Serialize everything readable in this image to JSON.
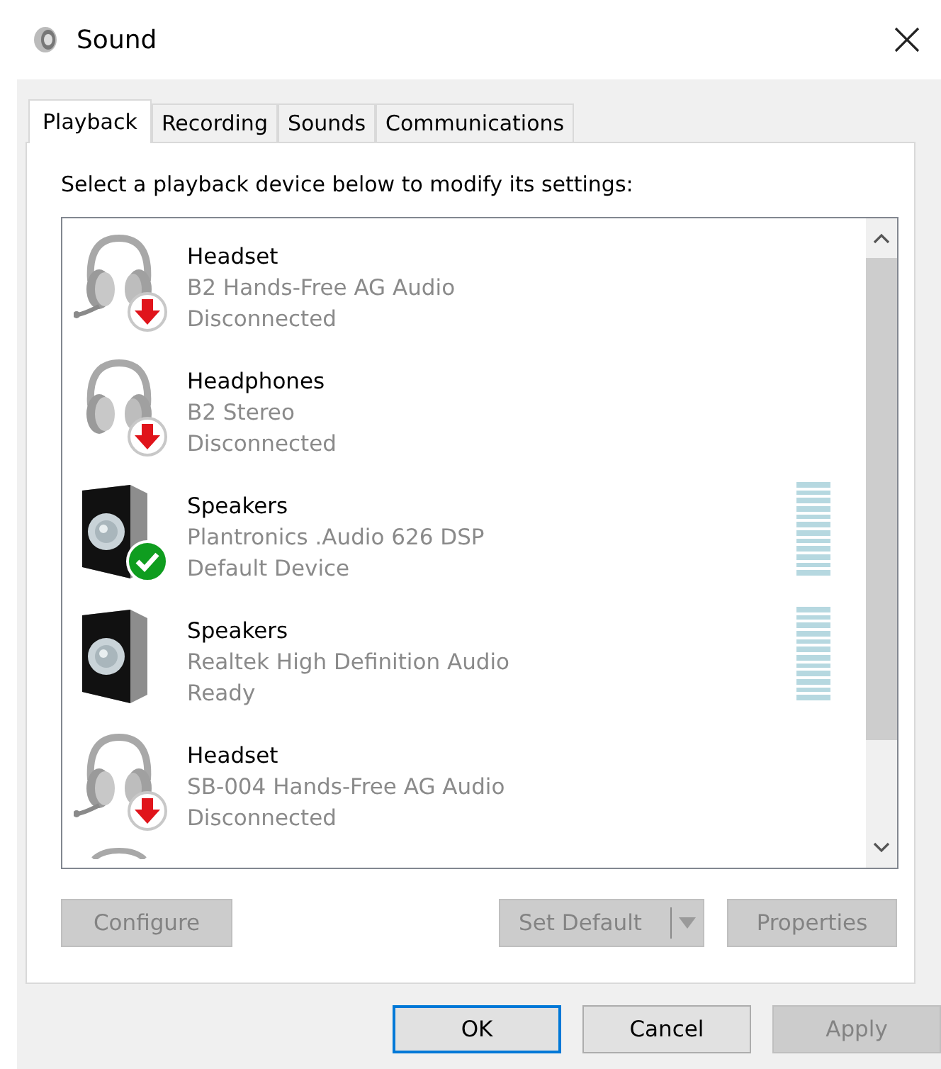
{
  "window": {
    "title": "Sound"
  },
  "tabs": [
    {
      "label": "Playback",
      "selected": true
    },
    {
      "label": "Recording",
      "selected": false
    },
    {
      "label": "Sounds",
      "selected": false
    },
    {
      "label": "Communications",
      "selected": false
    }
  ],
  "instruction": "Select a playback device below to modify its settings:",
  "devices": [
    {
      "kind": "headset",
      "disconnected": true,
      "default": false,
      "meter": false,
      "name": "Headset",
      "description": "B2 Hands-Free AG Audio",
      "status": "Disconnected"
    },
    {
      "kind": "headphones",
      "disconnected": true,
      "default": false,
      "meter": false,
      "name": "Headphones",
      "description": "B2 Stereo",
      "status": "Disconnected"
    },
    {
      "kind": "speakers",
      "disconnected": false,
      "default": true,
      "meter": true,
      "name": "Speakers",
      "description": "Plantronics .Audio 626 DSP",
      "status": "Default Device"
    },
    {
      "kind": "speakers",
      "disconnected": false,
      "default": false,
      "meter": true,
      "name": "Speakers",
      "description": "Realtek High Definition Audio",
      "status": "Ready"
    },
    {
      "kind": "headset",
      "disconnected": true,
      "default": false,
      "meter": false,
      "name": "Headset",
      "description": "SB-004 Hands-Free AG Audio",
      "status": "Disconnected"
    },
    {
      "kind": "headset",
      "cut_off": true
    }
  ],
  "device_buttons": [
    {
      "label": "Configure",
      "disabled": true,
      "kind": "plain"
    },
    {
      "label": "Set Default",
      "disabled": true,
      "kind": "split"
    },
    {
      "label": "Properties",
      "disabled": true,
      "kind": "plain"
    }
  ],
  "dialog_buttons": [
    {
      "label": "OK",
      "disabled": false,
      "default": true
    },
    {
      "label": "Cancel",
      "disabled": false,
      "default": false
    },
    {
      "label": "Apply",
      "disabled": true,
      "default": false
    }
  ]
}
